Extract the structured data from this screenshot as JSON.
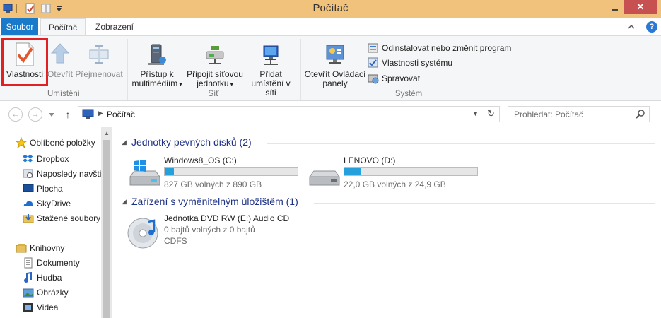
{
  "window": {
    "title": "Počítač"
  },
  "tabs": {
    "file": "Soubor",
    "computer": "Počítač",
    "view": "Zobrazení"
  },
  "ribbon": {
    "location": {
      "label": "Umístění",
      "properties": "Vlastnosti",
      "open": "Otevřít",
      "rename": "Přejmenovat"
    },
    "network": {
      "label": "Síť",
      "media_access": [
        "Přístup k",
        "multimédiím"
      ],
      "map_drive": [
        "Připojit síťovou",
        "jednotku"
      ],
      "add_location": [
        "Přidat",
        "umístění v síti"
      ]
    },
    "system": {
      "label": "Systém",
      "control_panel": [
        "Otevřít Ovládací",
        "panely"
      ],
      "uninstall": "Odinstalovat nebo změnit program",
      "system_properties": "Vlastnosti systému",
      "manage": "Spravovat"
    }
  },
  "address": {
    "path": "Počítač",
    "search_placeholder": "Prohledat: Počítač"
  },
  "nav_pane": {
    "favorites": "Oblíbené položky",
    "favorite_items": [
      "Dropbox",
      "Naposledy navšti",
      "Plocha",
      "SkyDrive",
      "Stažené soubory"
    ],
    "libraries": "Knihovny",
    "library_items": [
      "Dokumenty",
      "Hudba",
      "Obrázky",
      "Videa"
    ]
  },
  "content": {
    "hard_drives_header": "Jednotky pevných disků (2)",
    "drives": [
      {
        "name": "Windows8_OS (C:)",
        "free_text": "827 GB volných z 890 GB",
        "used_fraction": 0.07
      },
      {
        "name": "LENOVO (D:)",
        "free_text": "22,0 GB volných z 24,9 GB",
        "used_fraction": 0.12
      }
    ],
    "removable_header": "Zařízení s vyměnitelným úložištěm (1)",
    "dvd": {
      "name": "Jednotka DVD RW (E:) Audio CD",
      "free_text": "0 bajtů volných z 0 bajtů",
      "fs": "CDFS"
    }
  },
  "colors": {
    "titlebar": "#f0c27c",
    "file_tab": "#1979ca",
    "progress": "#26a0da",
    "highlight": "#e12024",
    "section": "#1e3287"
  }
}
